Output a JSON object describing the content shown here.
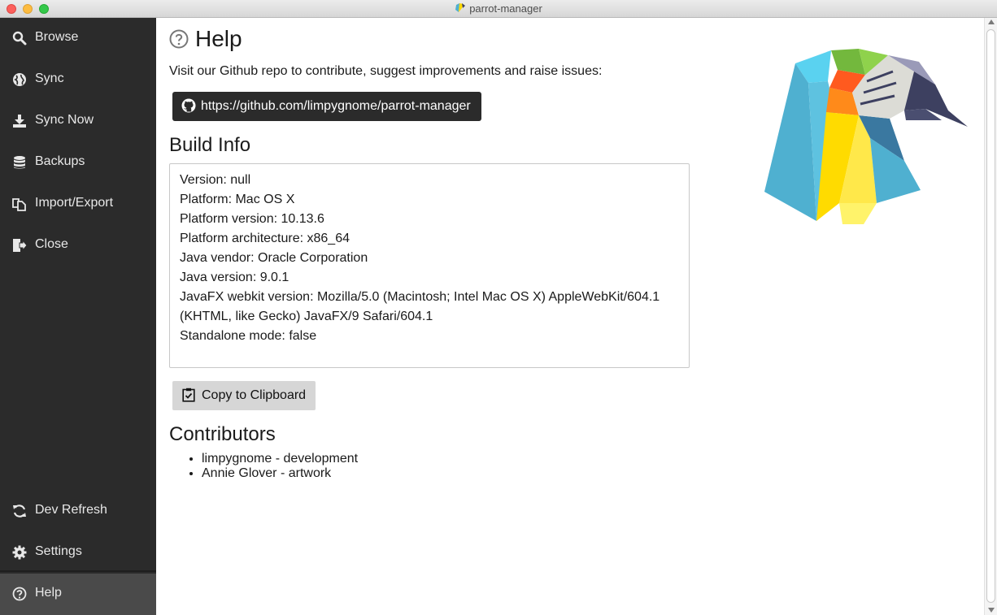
{
  "window": {
    "title": "parrot-manager"
  },
  "sidebar": {
    "items": [
      {
        "label": "Browse",
        "icon": "search-icon"
      },
      {
        "label": "Sync",
        "icon": "globe-icon"
      },
      {
        "label": "Sync Now",
        "icon": "download-icon"
      },
      {
        "label": "Backups",
        "icon": "database-icon"
      },
      {
        "label": "Import/Export",
        "icon": "copy-icon"
      },
      {
        "label": "Close",
        "icon": "sign-out-icon"
      }
    ],
    "bottom_items": [
      {
        "label": "Dev Refresh",
        "icon": "refresh-icon"
      },
      {
        "label": "Settings",
        "icon": "gear-icon"
      },
      {
        "label": "Help",
        "icon": "question-circle-icon",
        "active": true
      }
    ]
  },
  "help": {
    "title": "Help",
    "intro": "Visit our Github repo to contribute, suggest improvements and raise issues:",
    "github_link": "https://github.com/limpygnome/parrot-manager"
  },
  "build_info": {
    "heading": "Build Info",
    "lines": [
      "Version: null",
      "Platform: Mac OS X",
      "Platform version: 10.13.6",
      "Platform architecture: x86_64",
      "Java vendor: Oracle Corporation",
      "Java version: 9.0.1",
      "JavaFX webkit version: Mozilla/5.0 (Macintosh; Intel Mac OS X) AppleWebKit/604.1",
      "(KHTML, like Gecko) JavaFX/9 Safari/604.1",
      "Standalone mode: false"
    ],
    "copy_label": "Copy to Clipboard"
  },
  "contributors": {
    "heading": "Contributors",
    "items": [
      "limpygnome - development",
      "Annie Glover - artwork"
    ]
  },
  "colors": {
    "sidebar_bg": "#2b2b2b",
    "sidebar_active": "#4a4a4a",
    "github_button_bg": "#2b2b2b",
    "copy_button_bg": "#d6d6d6"
  }
}
